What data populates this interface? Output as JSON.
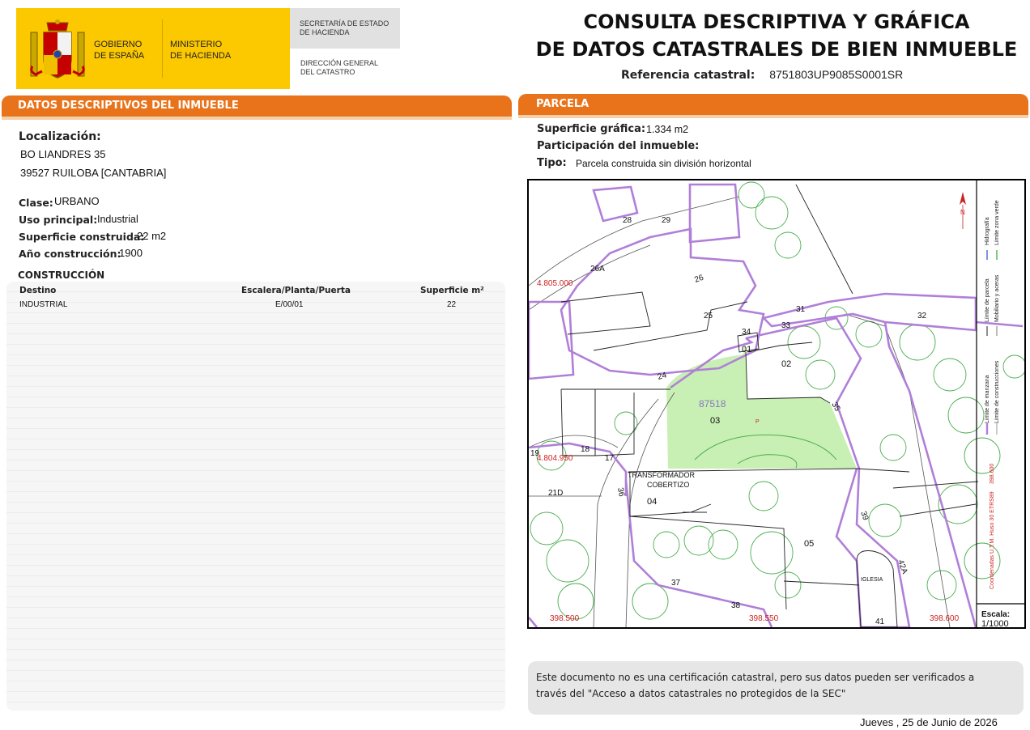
{
  "header": {
    "gov_line1": "GOBIERNO",
    "gov_line2": "DE ESPAÑA",
    "min_line1": "MINISTERIO",
    "min_line2": "DE HACIENDA",
    "sec_line1": "SECRETARÍA DE ESTADO",
    "sec_line2": "DE HACIENDA",
    "dir_line1": "DIRECCIÓN GENERAL",
    "dir_line2": "DEL CATASTRO",
    "title_line1": "CONSULTA DESCRIPTIVA Y GRÁFICA",
    "title_line2": "DE DATOS CATASTRALES DE BIEN INMUEBLE",
    "ref_label": "Referencia catastral:",
    "ref_value": "8751803UP9085S0001SR",
    "colors": {
      "brand_yellow": "#fcc800",
      "section_orange": "#e8731b"
    }
  },
  "left": {
    "section_title": "DATOS DESCRIPTIVOS DEL INMUEBLE",
    "loc_label": "Localización:",
    "address1": "BO LIANDRES 35",
    "address2": "39527 RUILOBA [CANTABRIA]",
    "clase_label": "Clase:",
    "clase_value": "URBANO",
    "uso_label": "Uso principal:",
    "uso_value": "Industrial",
    "sup_label": "Superficie construida:",
    "sup_value": "22 m2",
    "anio_label": "Año construcción:",
    "anio_value": "1900",
    "construccion_title": "CONSTRUCCIÓN",
    "table": {
      "headers": [
        "Destino",
        "Escalera/Planta/Puerta",
        "Superficie m²"
      ],
      "rows": [
        [
          "INDUSTRIAL",
          "E/00/01",
          "22"
        ]
      ]
    }
  },
  "right": {
    "section_title": "PARCELA",
    "sup_grafica_label": "Superficie gráfica:",
    "sup_grafica_value": "1.334 m2",
    "participacion_label": "Participación del inmueble:",
    "tipo_label": "Tipo:",
    "tipo_value": "Parcela construida sin división horizontal"
  },
  "map": {
    "parcel_number": "87518",
    "parcel_marker": "P",
    "coord_y1": "4.805.000",
    "coord_y2": "4.804.950",
    "coord_x1": "398.500",
    "coord_x2": "398.550",
    "coord_x3": "398.600",
    "labels_subparcel": [
      "01",
      "02",
      "03",
      "04",
      "05"
    ],
    "labels_numbers": [
      "28",
      "29",
      "26",
      "26A",
      "25",
      "24",
      "31",
      "32",
      "33",
      "34",
      "35",
      "36",
      "37",
      "38",
      "39",
      "41",
      "42A",
      "17",
      "18",
      "19",
      "21D"
    ],
    "label_transformador": "TRANSFORMADOR",
    "label_cobertizo": "COBERTIZO",
    "label_iglesia": "IGLESIA",
    "legend_manzana": "Límite de manzana",
    "legend_parcela": "Límite de parcela",
    "legend_hidrografia": "Hidrografía",
    "legend_construcciones": "Límite de construcciones",
    "legend_mobiliario": "Mobiliario y aceras",
    "legend_zona_verde": "Límite zona verde",
    "legend_coords": "Coordenadas U.T.M. Huso 30 ETRS89",
    "legend_coords_value": "398.600",
    "scale_label": "Escala:",
    "scale_value": "1/1000",
    "colors": {
      "parcel_fill": "#c8f0b4",
      "block_line": "#b07fd8",
      "tree_line": "#4caf50",
      "coord_text": "#cc2222"
    }
  },
  "footer": {
    "note_line1": "Este documento no es una certificación catastral, pero sus datos pueden ser verificados a",
    "note_line2": "través del \"Acceso a datos catastrales no protegidos de la SEC\"",
    "date": "Jueves , 25 de Junio de 2026"
  }
}
